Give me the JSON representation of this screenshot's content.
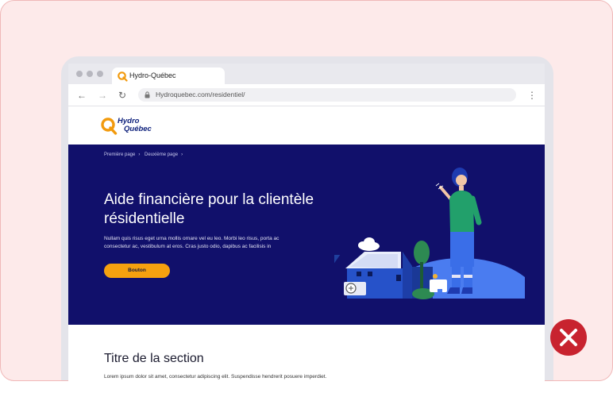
{
  "browser": {
    "tab_title": "Hydro-Québec",
    "url": "Hydroquebec.com/residentiel/"
  },
  "site": {
    "logo_line1": "Hydro",
    "logo_line2": "Québec"
  },
  "hero": {
    "breadcrumb": [
      "Première page",
      "Deuxième page"
    ],
    "title": "Aide financière pour la clientèle résidentielle",
    "body": "Nullam quis risus eget urna mollis ornare vel eu leo. Morbi leo risus, porta ac consectetur ac, vestibulum at eros. Cras justo odio, dapibus ac facilisis in",
    "button_label": "Bouton"
  },
  "section": {
    "title": "Titre de la section",
    "body": "Lorem ipsum dolor sit amet, consectetur adipiscing elit. Suspendisse hendrerit posuere imperdiet."
  },
  "colors": {
    "hero_background": "#11106b",
    "button": "#f6a10f",
    "error_badge": "#c8232f",
    "card_background": "#fdeaea"
  },
  "icons": [
    "hydro-quebec-logo-icon",
    "back-arrow-icon",
    "forward-arrow-icon",
    "reload-icon",
    "lock-icon",
    "more-vert-icon",
    "error-x-icon"
  ]
}
